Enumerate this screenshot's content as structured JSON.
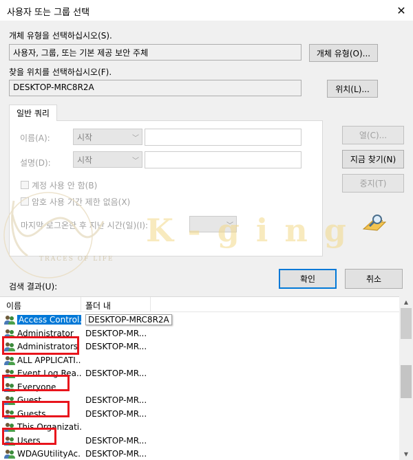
{
  "window": {
    "title": "사용자 또는 그룹 선택",
    "close_glyph": "✕"
  },
  "object_type": {
    "label": "개체 유형을 선택하십시오(S).",
    "value": "사용자, 그룹, 또는 기본 제공 보안 주체",
    "button": "개체 유형(O)..."
  },
  "location": {
    "label": "찾을 위치를 선택하십시오(F).",
    "value": "DESKTOP-MRC8R2A",
    "button": "위치(L)..."
  },
  "tab": {
    "label": "일반 쿼리"
  },
  "query": {
    "name_label": "이름(A):",
    "name_mode": "시작",
    "desc_label": "설명(D):",
    "desc_mode": "시작",
    "disabled_accounts": "계정 사용 안 함(B)",
    "non_expiring_pw": "암호 사용 기간 제한 없음(X)",
    "days_since_logon": "마지막 로그온한 후 지난 시간(일)(I):"
  },
  "buttons": {
    "columns": "열(C)...",
    "find_now": "지금 찾기(N)",
    "stop": "중지(T)",
    "ok": "확인",
    "cancel": "취소"
  },
  "results": {
    "label": "검색 결과(U):",
    "columns": [
      "이름",
      "폴더 내"
    ],
    "rows": [
      {
        "name": "Access Control...",
        "folder": "DESKTOP-MRC8R2A"
      },
      {
        "name": "Administrator",
        "folder": "DESKTOP-MR..."
      },
      {
        "name": "Administrators",
        "folder": "DESKTOP-MR..."
      },
      {
        "name": "ALL APPLICATI...",
        "folder": ""
      },
      {
        "name": "Event Log Rea...",
        "folder": "DESKTOP-MR..."
      },
      {
        "name": "Everyone",
        "folder": ""
      },
      {
        "name": "Guest",
        "folder": "DESKTOP-MR..."
      },
      {
        "name": "Guests",
        "folder": "DESKTOP-MR..."
      },
      {
        "name": "This Organizati...",
        "folder": ""
      },
      {
        "name": "Users",
        "folder": "DESKTOP-MR..."
      },
      {
        "name": "WDAGUtilityAc...",
        "folder": "DESKTOP-MR..."
      }
    ]
  },
  "watermark": {
    "text": "K-ging",
    "tagline": "TRACES OF LIFE"
  },
  "colors": {
    "accent": "#0078d7",
    "highlight_box": "#e8141c",
    "watermark": "#f3d98a"
  },
  "icons": {
    "search_tool": "magnifier-icon",
    "row": "user-group-icon",
    "close": "close-icon"
  }
}
